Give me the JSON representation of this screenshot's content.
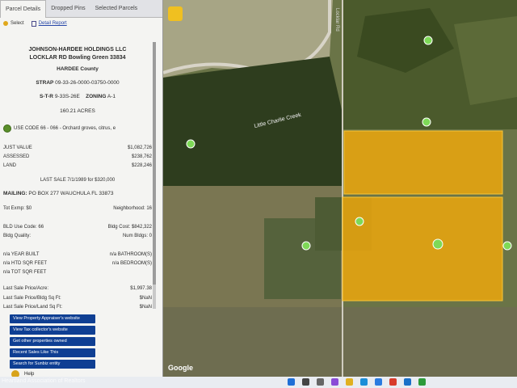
{
  "tabs": [
    "Parcel Details",
    "Dropped Pins",
    "Selected Parcels"
  ],
  "toolbar": {
    "select_label": "Select",
    "report_label": "Detail Report"
  },
  "owner": {
    "line1": "JOHNSON-HARDEE HOLDINGS LLC",
    "line2": "LOCKLAR RD Bowling Green 33834"
  },
  "county": "HARDEE County",
  "strap": {
    "label": "STRAP",
    "value": "09-33-26-0000-03750-0000"
  },
  "str": {
    "label": "S-T-R",
    "value": "9-33S-26E",
    "zoning_label": "ZONING",
    "zoning_value": "A-1"
  },
  "acres": "160.21 ACRES",
  "use_code": "USE CODE 66 - 066 - Orchard groves, citrus, e",
  "values": {
    "just_label": "JUST VALUE",
    "just": "$1,082,726",
    "assessed_label": "ASSESSED",
    "assessed": "$238,762",
    "land_label": "LAND",
    "land": "$228,246"
  },
  "last_sale": {
    "label": "LAST SALE",
    "date": "7/1/1989",
    "for": "for",
    "amount": "$320,000"
  },
  "mailing": {
    "label": "MAILING:",
    "value": "PO BOX 277 WAUCHULA FL 33873"
  },
  "tot_exmp": {
    "label": "Tot Exmp:",
    "value": "$0",
    "neigh_label": "Neighborhood:",
    "neigh_value": "16"
  },
  "bld": {
    "use_label": "BLD Use Code:",
    "use_value": "66",
    "cost_label": "Bldg Cost:",
    "cost_value": "$842,322",
    "quality_label": "Bldg Quality:",
    "quality_value": "",
    "num_label": "Num Bldgs:",
    "num_value": "0"
  },
  "misc": {
    "year_built": "n/a YEAR BUILT",
    "bathrooms": "n/a BATHROOM(S)",
    "htd": "n/a HTD SQR FEET",
    "bedrooms": "n/a BEDROOM(S)",
    "tot": "n/a TOT SQR FEET"
  },
  "prices": {
    "acre_label": "Last Sale Price/Acre:",
    "acre_value": "$1,997.38",
    "bldg_label": "Last Sale Price/Bldg Sq Ft:",
    "bldg_value": "$NaN",
    "land_label": "Last Sale Price/Land Sq Ft:",
    "land_value": "$NaN"
  },
  "buttons": [
    "View Property Appraiser's website",
    "View Tax collector's website",
    "Get other properties owned",
    "Recent Sales Like This",
    "Search for Sunbiz entity"
  ],
  "bottom_text": "Help",
  "map": {
    "road_label": "Locklar Rd",
    "creek_label": "Little Charlie Creek",
    "google_label": "Google"
  },
  "watermark": "Heartland Association of Realtors",
  "colors": {
    "accent": "#0f3f93",
    "parcel_fill": "#e8a50f",
    "marker": "#7ed957"
  }
}
